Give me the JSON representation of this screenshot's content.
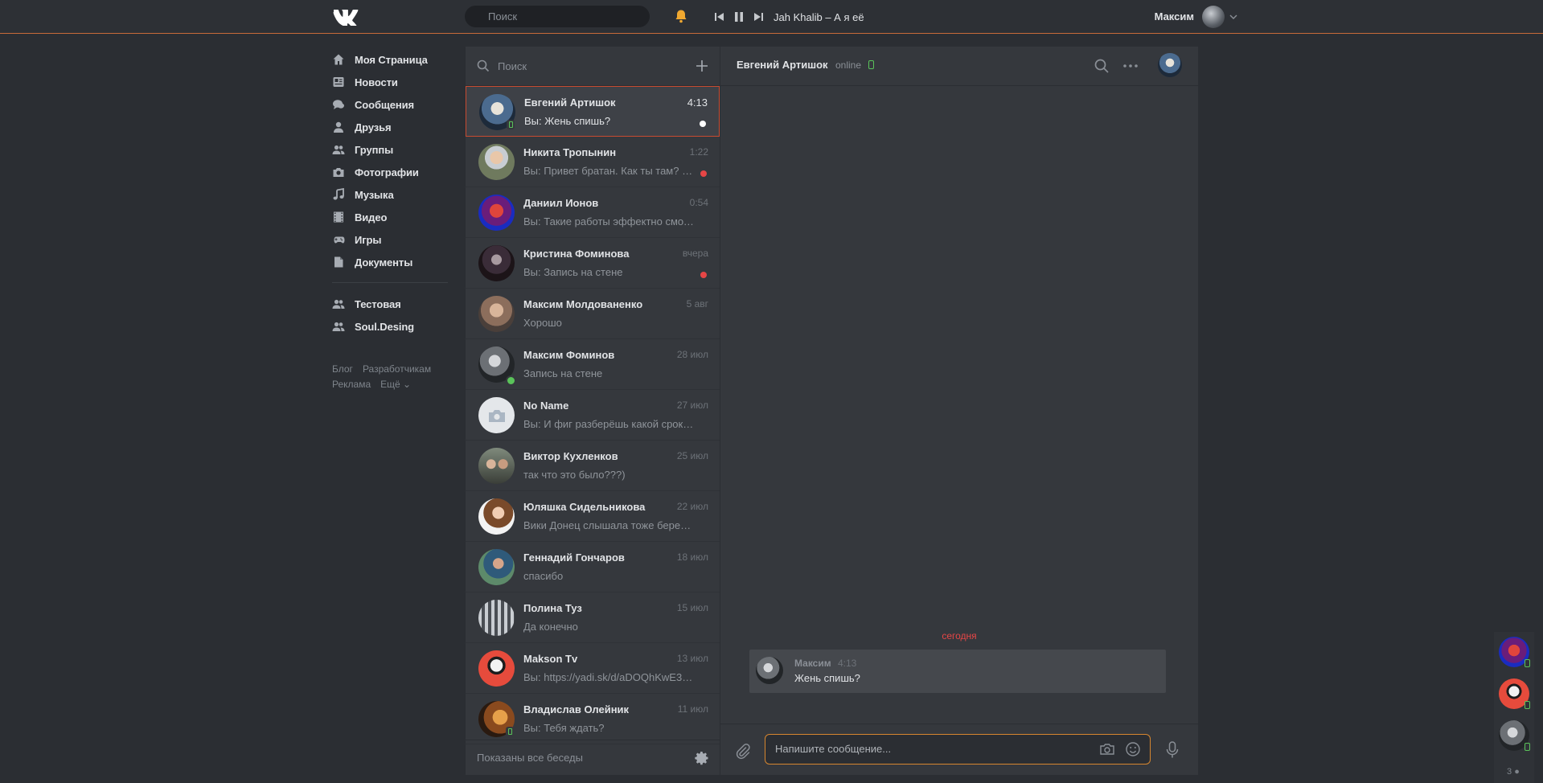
{
  "header": {
    "search_placeholder": "Поиск",
    "track": "Jah Khalib – А я её",
    "user_name": "Максим"
  },
  "nav": {
    "items": [
      {
        "label": "Моя Страница",
        "icon": "home-icon"
      },
      {
        "label": "Новости",
        "icon": "news-icon"
      },
      {
        "label": "Сообщения",
        "icon": "messages-icon"
      },
      {
        "label": "Друзья",
        "icon": "friends-icon"
      },
      {
        "label": "Группы",
        "icon": "groups-icon"
      },
      {
        "label": "Фотографии",
        "icon": "camera-icon"
      },
      {
        "label": "Музыка",
        "icon": "music-icon"
      },
      {
        "label": "Видео",
        "icon": "video-icon"
      },
      {
        "label": "Игры",
        "icon": "gamepad-icon"
      },
      {
        "label": "Документы",
        "icon": "document-icon"
      }
    ],
    "groups": [
      {
        "label": "Тестовая",
        "icon": "group-icon"
      },
      {
        "label": "Soul.Desing",
        "icon": "group-icon"
      }
    ],
    "footer": [
      "Блог",
      "Разработчикам",
      "Реклама",
      "Ещё ⌄"
    ]
  },
  "dialogs": {
    "search_placeholder": "Поиск",
    "footer_text": "Показаны все беседы",
    "items": [
      {
        "name": "Евгений Артишок",
        "time": "4:13",
        "msg": "Вы: Жень спишь?"
      },
      {
        "name": "Никита Тропынин",
        "time": "1:22",
        "msg": "Вы: Привет братан. Как ты там? Ч..."
      },
      {
        "name": "Даниил Ионов",
        "time": "0:54",
        "msg": "Вы: Такие работы эффектно смотрят..."
      },
      {
        "name": "Кристина Фоминова",
        "time": "вчера",
        "msg": "Вы: Запись на стене"
      },
      {
        "name": "Максим Молдованенко",
        "time": "5 авг",
        "msg": "Хорошо"
      },
      {
        "name": "Максим Фоминов",
        "time": "28 июл",
        "msg": "Запись на стене"
      },
      {
        "name": "No Name",
        "time": "27 июл",
        "msg": "Вы: И фиг разберёшь какой срок пра..."
      },
      {
        "name": "Виктор Кухленков",
        "time": "25 июл",
        "msg": "так что это было???)"
      },
      {
        "name": "Юляшка Сидельникова",
        "time": "22 июл",
        "msg": "Вики Донец слышала тоже беременн..."
      },
      {
        "name": "Геннадий Гончаров",
        "time": "18 июл",
        "msg": "спасибо"
      },
      {
        "name": "Полина Туз",
        "time": "15 июл",
        "msg": "Да конечно"
      },
      {
        "name": "Makson Tv",
        "time": "13 июл",
        "msg": "Вы: https://yadi.sk/d/aDOQhKwE3Z9W..."
      },
      {
        "name": "Владислав Олейник",
        "time": "11 июл",
        "msg": "Вы: Тебя ждать?"
      }
    ]
  },
  "chat": {
    "name": "Евгений Артишок",
    "status": "online",
    "day_label": "сегодня",
    "message": {
      "author": "Максим",
      "time": "4:13",
      "text": "Жень спишь?"
    },
    "input_placeholder": "Напишите сообщение..."
  },
  "side": {
    "count": "3"
  },
  "colors": {
    "accent": "#d6862f",
    "unread": "#e64646",
    "online": "#5ac35a",
    "bg": "#2b2e33",
    "panel": "#35383d"
  }
}
